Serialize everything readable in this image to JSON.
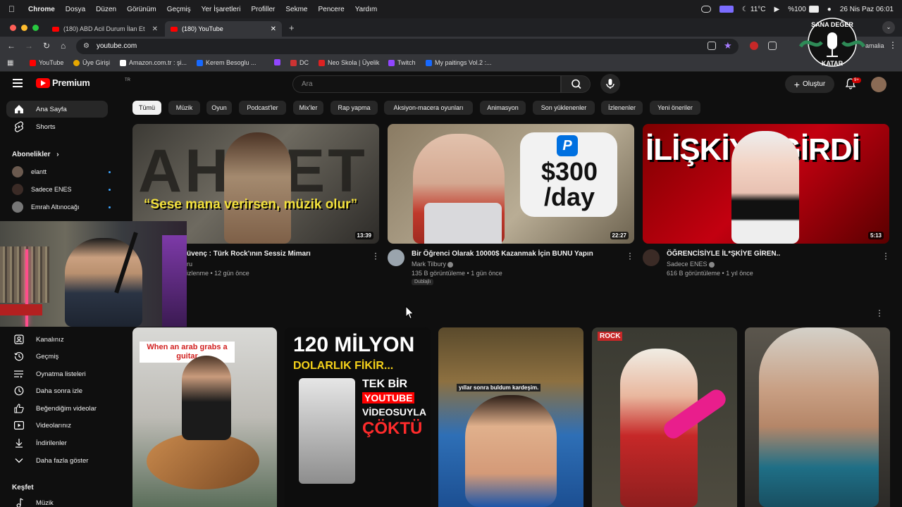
{
  "menubar": {
    "app": "Chrome",
    "items": [
      "Dosya",
      "Düzen",
      "Görünüm",
      "Geçmiş",
      "Yer İşaretleri",
      "Profiller",
      "Sekme",
      "Pencere",
      "Yardım"
    ],
    "temperature": "11°C",
    "battery": "%100",
    "datetime": "26 Nis Paz  06:01"
  },
  "tabs": [
    {
      "label": "(180) ABD Acil Durum İlan Et",
      "active": false
    },
    {
      "label": "(180) YouTube",
      "active": true
    }
  ],
  "address": {
    "url": "youtube.com",
    "profile_chip": "amalia"
  },
  "bookmarks": [
    {
      "label": "YouTube",
      "color": "#ff0000"
    },
    {
      "label": "Üye Girişi",
      "color": "#e6a700"
    },
    {
      "label": "Amazon.com.tr : şi...",
      "color": "#ffffff"
    },
    {
      "label": "Kerem Besoglu ...",
      "color": "#1769ff"
    },
    {
      "label": "",
      "color": "#9146ff"
    },
    {
      "label": "DC",
      "color": "#cc3333"
    },
    {
      "label": "Neo Skola | Üyelik",
      "color": "#dd2222"
    },
    {
      "label": "Twitch",
      "color": "#9146ff"
    },
    {
      "label": "My paitings Vol.2 :...",
      "color": "#1769ff"
    }
  ],
  "youtube": {
    "logo": "Premium",
    "logo_tm": "TR",
    "search_placeholder": "Ara",
    "create_label": "Oluştur",
    "notif_badge": "9+"
  },
  "sidebar": {
    "top": [
      {
        "label": "Ana Sayfa",
        "icon": "home-icon",
        "active": true
      },
      {
        "label": "Shorts",
        "icon": "shorts-icon",
        "active": false
      }
    ],
    "subs_header": "Abonelikler",
    "subscriptions": [
      {
        "label": "elantt",
        "color": "#6b5a4f"
      },
      {
        "label": "Sadece ENES",
        "color": "#3b2b26"
      },
      {
        "label": "Emrah Altınocağı",
        "color": "#777777"
      }
    ],
    "you_items": [
      {
        "label": "Kanalınız",
        "icon": "account-icon"
      },
      {
        "label": "Geçmiş",
        "icon": "history-icon"
      },
      {
        "label": "Oynatma listeleri",
        "icon": "playlist-icon"
      },
      {
        "label": "Daha sonra izle",
        "icon": "clock-icon"
      },
      {
        "label": "Beğendiğim videolar",
        "icon": "like-icon"
      },
      {
        "label": "Videolarınız",
        "icon": "video-icon"
      },
      {
        "label": "İndirilenler",
        "icon": "download-icon"
      },
      {
        "label": "Daha fazla göster",
        "icon": "chevron-down-icon"
      }
    ],
    "explore_header": "Keşfet",
    "explore_items": [
      {
        "label": "Müzik",
        "icon": "music-icon"
      }
    ]
  },
  "chips": [
    "Tümü",
    "Müzik",
    "Oyun",
    "Podcast'ler",
    "Mix'ler",
    "Rap yapma",
    "Aksiyon-macera oyunları",
    "Animasyon",
    "Son yüklenenler",
    "İzlenenler",
    "Yeni öneriler"
  ],
  "videos": [
    {
      "title": "üvenç : Türk Rock'ının Sessiz Mimarı",
      "channel": "ru",
      "meta": "izlenme • 12 gün önce",
      "duration": "13:39",
      "thumb_text": "“Sese mana verirsen, müzik olur”",
      "bg_text": "AHMET"
    },
    {
      "title": "Bir Öğrenci Olarak 10000$ Kazanmak İçin BUNU Yapın",
      "channel": "Mark Tilbury",
      "meta": "135 B görüntüleme • 1 gün önce",
      "duration": "22:27",
      "badge": "Dublajlı",
      "thumb_text": "$300 /day"
    },
    {
      "title": "ÖĞRENCİSİYLE İL*ŞKİYE GİREN..",
      "channel": "Sadece ENES",
      "meta": "616 B görüntüleme • 1 yıl önce",
      "duration": "5:13",
      "thumb_text": "İLİŞKİYE GİRDİ"
    }
  ],
  "shorts": [
    {
      "thumb_text": "When an arab grabs a guitar"
    },
    {
      "thumb_text_top": "120 MİLYON",
      "thumb_text_mid": "DOLARLIK FİKİR...",
      "thumb_text_white": "TEK BİR",
      "thumb_text_yt": "YOUTUBE",
      "thumb_text_white2": "VİDEOSUYLA",
      "thumb_text_red": "ÇÖKTÜ"
    },
    {
      "thumb_text": "yıllar sonra buldum kardeşim."
    },
    {
      "thumb_text": "ROCK"
    },
    {
      "thumb_text": ""
    }
  ],
  "watermark": {
    "top": "SANA DEĞER",
    "bottom": "KATAR"
  }
}
